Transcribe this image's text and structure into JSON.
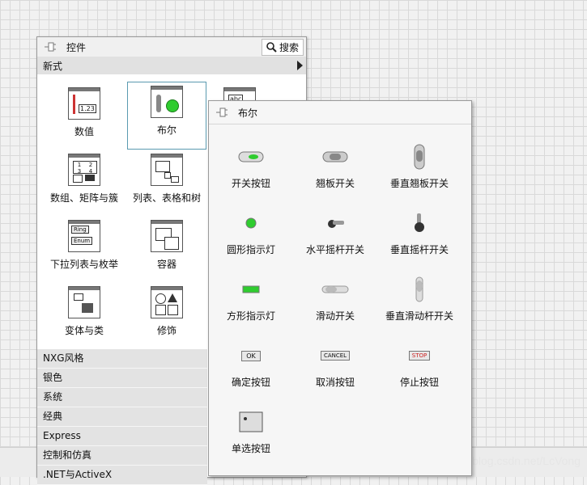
{
  "palette": {
    "title": "控件",
    "search_label": "搜索",
    "category": "新式",
    "items": [
      {
        "label": "数值",
        "icon": "numeric-icon"
      },
      {
        "label": "布尔",
        "icon": "boolean-icon"
      },
      {
        "label": "",
        "icon": "string-icon"
      },
      {
        "label": "数组、矩阵与簇",
        "icon": "array-icon"
      },
      {
        "label": "列表、表格和树",
        "icon": "list-table-icon"
      },
      {
        "label": "下拉列表与枚举",
        "icon": "ring-enum-icon"
      },
      {
        "label": "容器",
        "icon": "container-icon"
      },
      {
        "label": "变体与类",
        "icon": "variant-class-icon"
      },
      {
        "label": "修饰",
        "icon": "decoration-icon"
      }
    ],
    "categories": [
      "NXG风格",
      "银色",
      "系统",
      "经典",
      "Express",
      "控制和仿真",
      ".NET与ActiveX"
    ],
    "icon_text": {
      "numeric": "1.23",
      "array": [
        "1",
        "2",
        "3",
        "4"
      ],
      "ring": "Ring",
      "enum": "Enum",
      "string": "abc"
    }
  },
  "boolean_palette": {
    "title": "布尔",
    "items": [
      {
        "label": "开关按钮",
        "icon": "push-button-icon"
      },
      {
        "label": "翘板开关",
        "icon": "rocker-switch-icon"
      },
      {
        "label": "垂直翘板开关",
        "icon": "vertical-rocker-icon"
      },
      {
        "label": "圆形指示灯",
        "icon": "round-led-icon"
      },
      {
        "label": "水平摇杆开关",
        "icon": "horizontal-toggle-icon"
      },
      {
        "label": "垂直摇杆开关",
        "icon": "vertical-toggle-icon"
      },
      {
        "label": "方形指示灯",
        "icon": "square-led-icon"
      },
      {
        "label": "滑动开关",
        "icon": "slide-switch-icon"
      },
      {
        "label": "垂直滑动杆开关",
        "icon": "vertical-slide-icon"
      },
      {
        "label": "确定按钮",
        "icon": "ok-button-icon"
      },
      {
        "label": "取消按钮",
        "icon": "cancel-button-icon"
      },
      {
        "label": "停止按钮",
        "icon": "stop-button-icon"
      },
      {
        "label": "单选按钮",
        "icon": "radio-buttons-icon"
      }
    ],
    "button_text": {
      "ok": "OK",
      "cancel": "CANCEL",
      "stop": "STOP"
    }
  },
  "watermark": "https://blog.csdn.net/LcVong",
  "colors": {
    "led_green": "#2fcc2f",
    "selection": "#5a9ab0",
    "stop_red": "#cc2222"
  }
}
